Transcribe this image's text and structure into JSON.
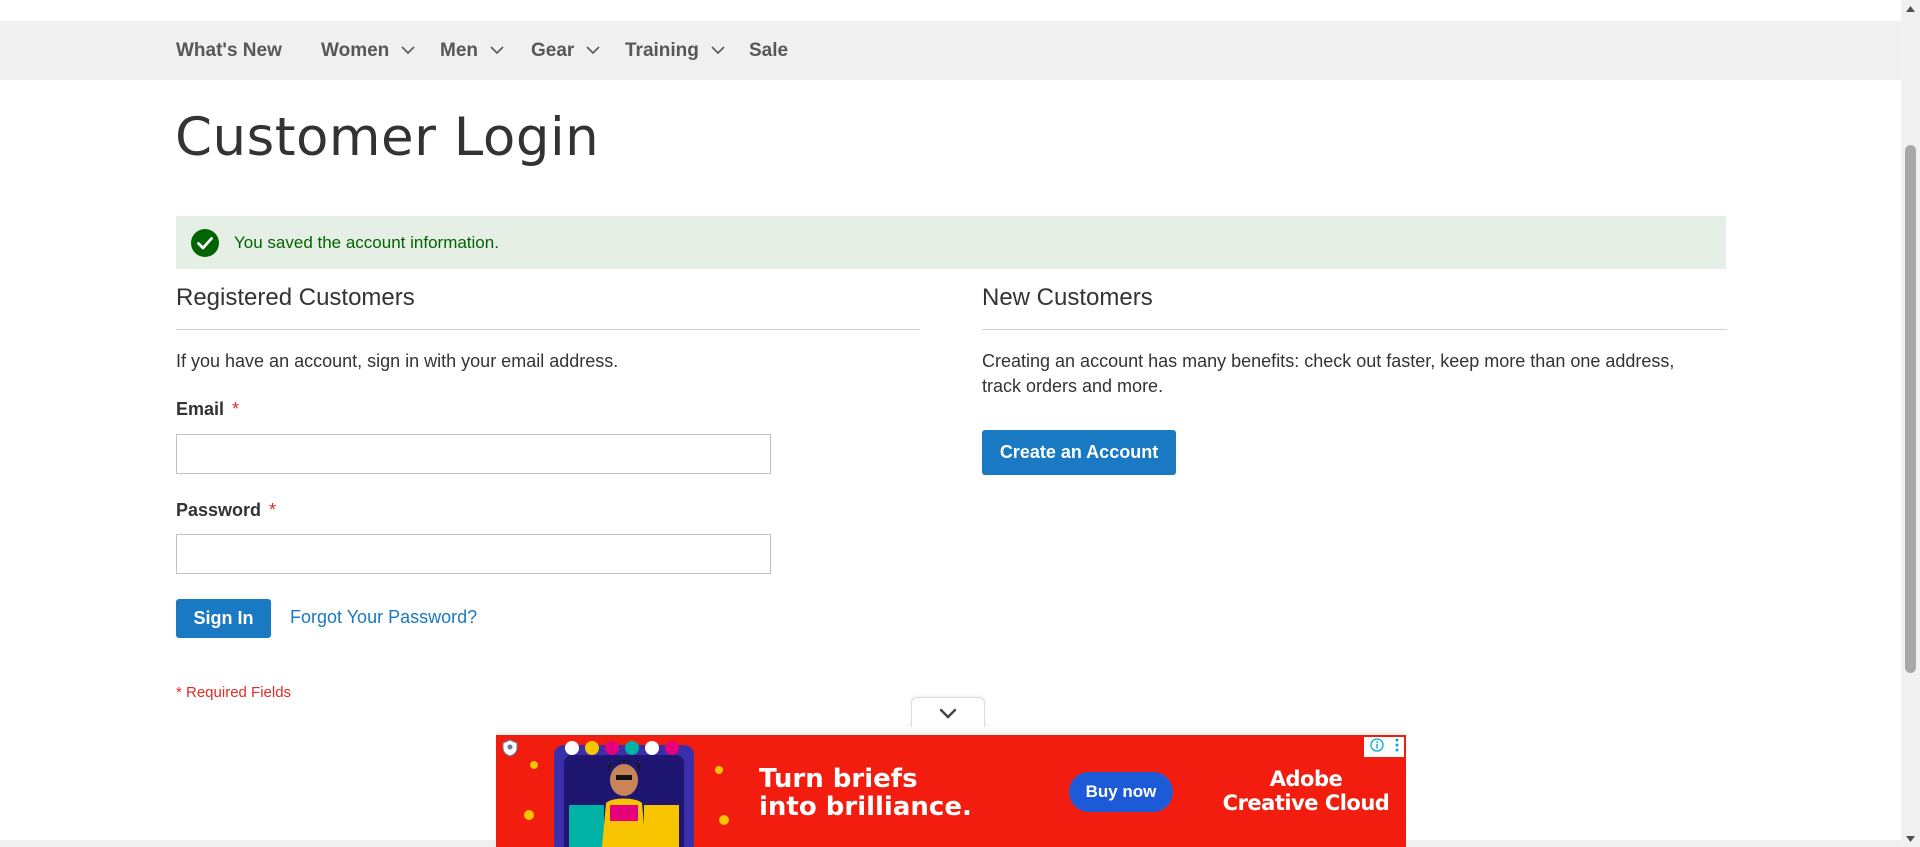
{
  "nav": {
    "items": [
      {
        "label": "What's New",
        "has_dropdown": false
      },
      {
        "label": "Women",
        "has_dropdown": true
      },
      {
        "label": "Men",
        "has_dropdown": true
      },
      {
        "label": "Gear",
        "has_dropdown": true
      },
      {
        "label": "Training",
        "has_dropdown": true
      },
      {
        "label": "Sale",
        "has_dropdown": false
      }
    ],
    "icon": "chevron-down-icon"
  },
  "page_title": "Customer Login",
  "message": {
    "text": "You saved the account information.",
    "icon": "check-circle-icon",
    "type": "success"
  },
  "registered": {
    "title": "Registered Customers",
    "intro": "If you have an account, sign in with your email address.",
    "email_label": "Email",
    "email_value": "",
    "password_label": "Password",
    "password_value": "",
    "required_star": "*",
    "sign_in_label": "Sign In",
    "forgot_label": "Forgot Your Password?",
    "required_note": "* Required Fields"
  },
  "new_customers": {
    "title": "New Customers",
    "intro": "Creating an account has many benefits: check out faster, keep more than one address, track orders and more.",
    "create_label": "Create an Account"
  },
  "ad": {
    "headline_line1": "Turn briefs",
    "headline_line2": "into brilliance.",
    "cta": "Buy now",
    "brand_line1": "Adobe",
    "brand_line2": "Creative Cloud",
    "info_icon": "info-icon",
    "menu_icon": "more-vertical-icon",
    "collapse_icon": "chevron-down-icon"
  },
  "colors": {
    "primary": "#1979c3",
    "nav_bg": "#f0f0f0",
    "success_bg": "#e5efe5",
    "success_text": "#006400",
    "required": "#e02b27",
    "ad_bg": "#f21c0f",
    "ad_button": "#1d5ad8"
  }
}
